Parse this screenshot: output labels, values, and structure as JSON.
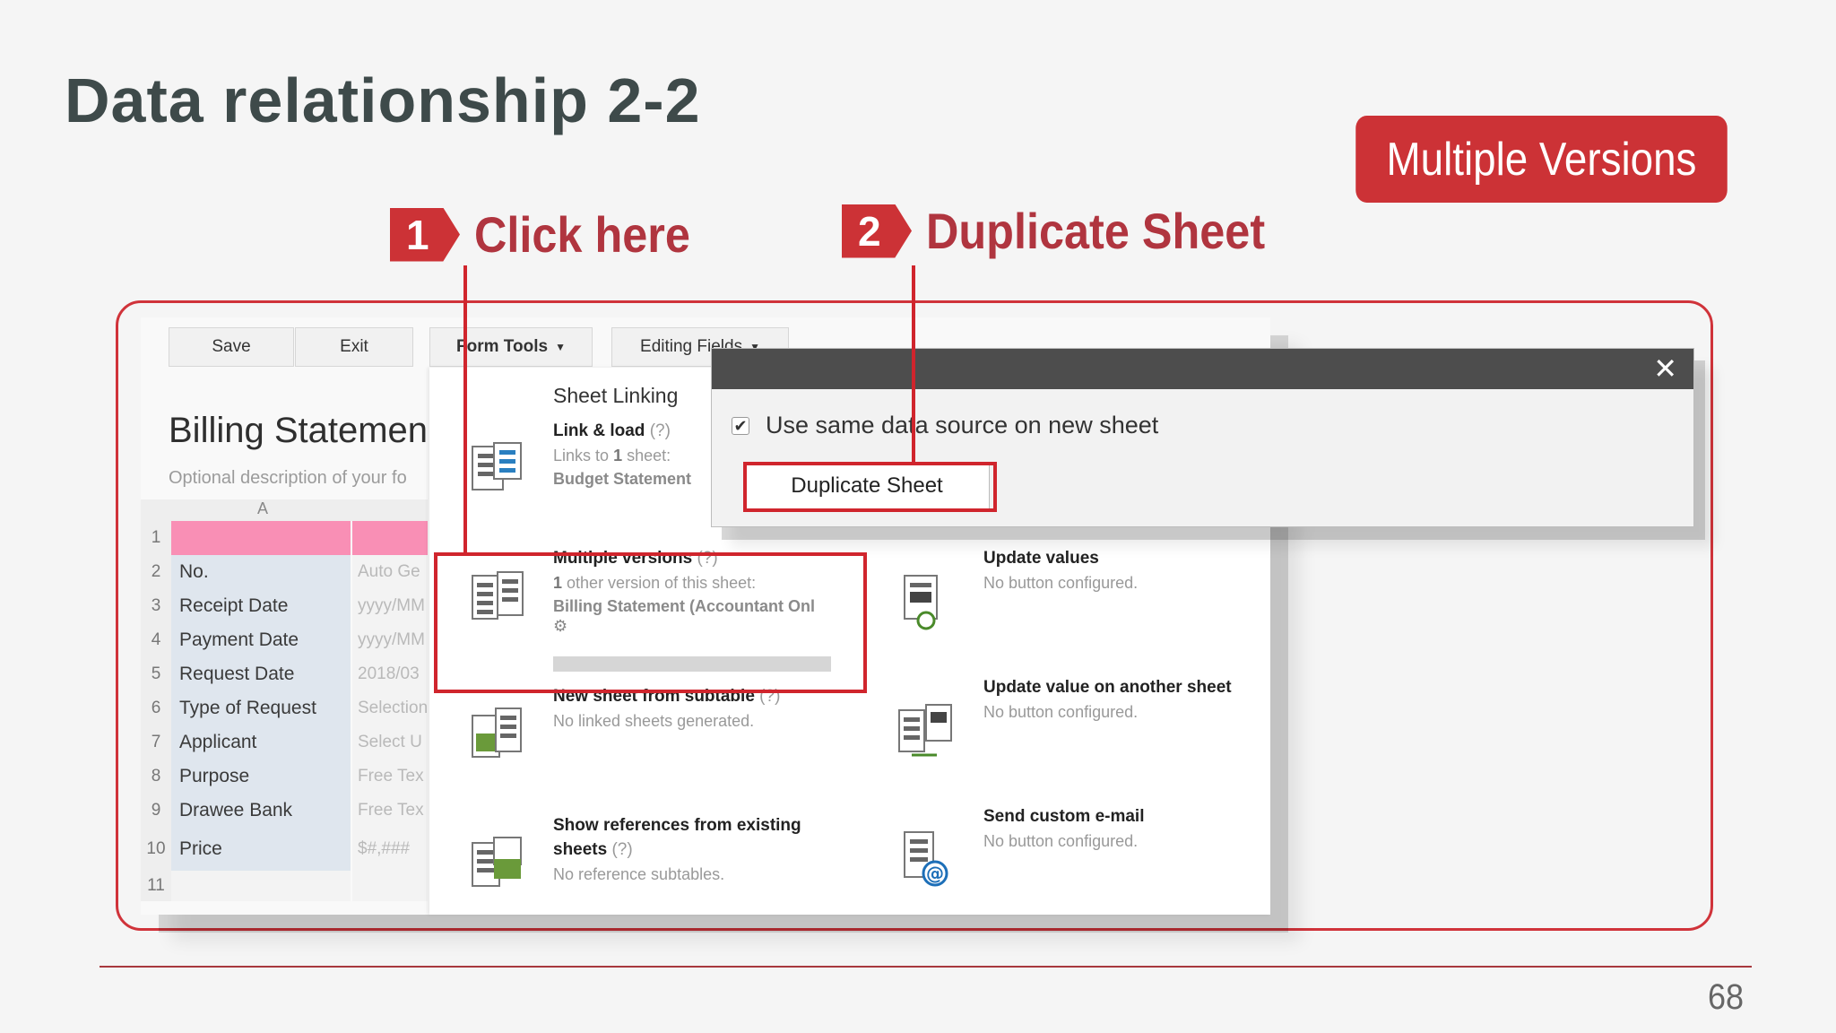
{
  "slide": {
    "title": "Data relationship 2-2",
    "tag": "Multiple Versions",
    "page_number": "68"
  },
  "steps": [
    {
      "number": "1",
      "label": "Click here"
    },
    {
      "number": "2",
      "label": "Duplicate Sheet"
    }
  ],
  "toolbar": {
    "save": "Save",
    "exit": "Exit",
    "form_tools": "Form Tools",
    "editing_fields": "Editing Fields"
  },
  "form": {
    "title": "Billing Statemen",
    "description": "Optional description of your fo",
    "column_header": "A",
    "rows": [
      {
        "num": "1",
        "label": "",
        "value": ""
      },
      {
        "num": "2",
        "label": "No.",
        "value": "Auto Ge"
      },
      {
        "num": "3",
        "label": "Receipt Date",
        "value": "yyyy/MM"
      },
      {
        "num": "4",
        "label": "Payment Date",
        "value": "yyyy/MM"
      },
      {
        "num": "5",
        "label": "Request Date",
        "value": "2018/03"
      },
      {
        "num": "6",
        "label": "Type of Request",
        "value": "Selection"
      },
      {
        "num": "7",
        "label": "Applicant",
        "value": "Select U"
      },
      {
        "num": "8",
        "label": "Purpose",
        "value": "Free Tex"
      },
      {
        "num": "9",
        "label": "Drawee Bank",
        "value": "Free Tex"
      },
      {
        "num": "10",
        "label": "Price",
        "value": "$#,###"
      },
      {
        "num": "11",
        "label": "",
        "value": ""
      }
    ]
  },
  "menu": {
    "heading": "Sheet Linking",
    "link_load": {
      "title": "Link & load",
      "q": "(?)",
      "sub_prefix": "Links to",
      "sub_count": "1",
      "sub_suffix": "sheet:",
      "value": "Budget Statement"
    },
    "multiple_versions": {
      "title": "Multiple versions",
      "q": "(?)",
      "sub_count": "1",
      "sub_suffix": "other version of this sheet:",
      "value": "Billing Statement (Accountant Onl"
    },
    "new_sheet": {
      "title": "New sheet from subtable",
      "q": "(?)",
      "sub": "No linked sheets generated."
    },
    "show_refs": {
      "title_line1": "Show references from existing",
      "title_line2": "sheets",
      "q": "(?)",
      "sub": "No reference subtables."
    },
    "update_values": {
      "title": "Update values",
      "sub": "No button configured."
    },
    "update_other": {
      "title": "Update value on another sheet",
      "sub": "No button configured."
    },
    "send_email": {
      "title": "Send custom e-mail",
      "sub": "No button configured."
    }
  },
  "dialog": {
    "close": "✕",
    "checkbox_label": "Use same data source on new sheet",
    "checked": true,
    "button": "Duplicate Sheet"
  },
  "colors": {
    "accent": "#cc3236",
    "pink_row": "#f98fb5",
    "dialog_bar": "#4d4d4d"
  }
}
